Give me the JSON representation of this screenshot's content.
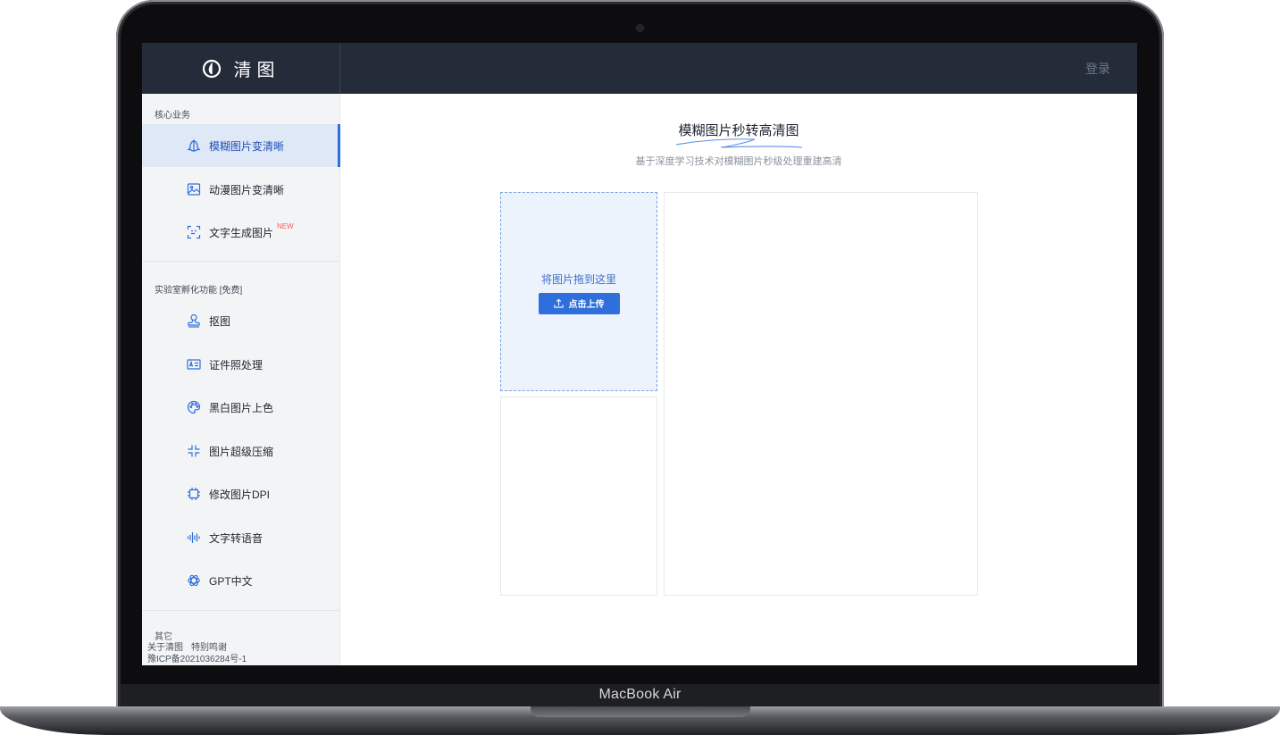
{
  "device": {
    "label": "MacBook Air"
  },
  "header": {
    "brand": "清图",
    "login": "登录"
  },
  "sidebar": {
    "core_title": "核心业务",
    "core_items": [
      {
        "label": "模糊图片变清晰",
        "icon": "face-split-icon",
        "active": true
      },
      {
        "label": "动漫图片变清晰",
        "icon": "image-icon"
      },
      {
        "label": "文字生成图片",
        "icon": "scan-text-icon",
        "badge": "NEW"
      }
    ],
    "lab_title": "实验室孵化功能 [免费]",
    "lab_items": [
      {
        "label": "抠图",
        "icon": "stamp-icon"
      },
      {
        "label": "证件照处理",
        "icon": "id-card-icon"
      },
      {
        "label": "黑白图片上色",
        "icon": "palette-icon"
      },
      {
        "label": "图片超级压缩",
        "icon": "compress-icon"
      },
      {
        "label": "修改图片DPI",
        "icon": "chip-icon"
      },
      {
        "label": "文字转语音",
        "icon": "waveform-icon"
      },
      {
        "label": "GPT中文",
        "icon": "openai-icon"
      }
    ],
    "other_title": "其它",
    "links": [
      "关于清图",
      "特别鸣谢"
    ],
    "icp": "豫ICP备2021036284号-1"
  },
  "main": {
    "title": "模糊图片秒转高清图",
    "subtitle": "基于深度学习技术对模糊图片秒级处理重建高清",
    "drop_text": "将图片拖到这里",
    "upload_button": "点击上传"
  },
  "colors": {
    "accent": "#2f6fdc",
    "topbar": "#242c3a",
    "sidebar": "#f3f4f6",
    "active_bg": "#dfe8f7",
    "badge": "#ff5a5a"
  }
}
